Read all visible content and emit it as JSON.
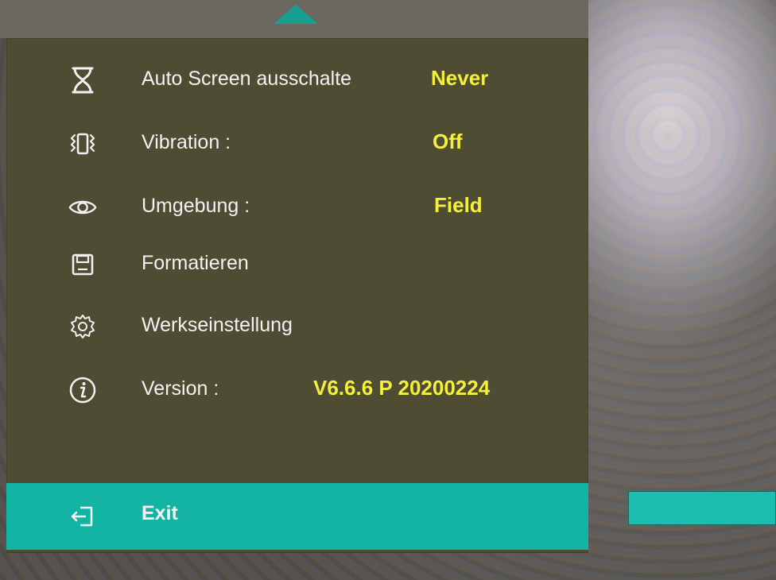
{
  "settings": {
    "items": [
      {
        "label": "Auto Screen ausschalte",
        "value": "Never",
        "icon": "hourglass-icon"
      },
      {
        "label": "Vibration :",
        "value": "Off",
        "icon": "vibration-icon"
      },
      {
        "label": "Umgebung :",
        "value": "Field",
        "icon": "eye-icon"
      },
      {
        "label": "Formatieren",
        "value": "",
        "icon": "save-icon"
      },
      {
        "label": "Werkseinstellung",
        "value": "",
        "icon": "gear-icon"
      },
      {
        "label": "Version :",
        "value": "V6.6.6 P 20200224",
        "icon": "info-icon"
      }
    ],
    "exit_label": "Exit"
  },
  "colors": {
    "panel": "#4f4c34",
    "value_text": "#f4ef39",
    "label_text": "#f2f2f2",
    "accent": "#14b4a4"
  }
}
